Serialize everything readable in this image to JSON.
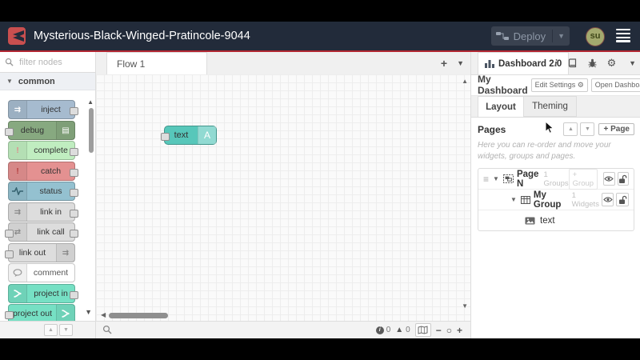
{
  "header": {
    "title": "Mysterious-Black-Winged-Pratincole-9044",
    "deploy_label": "Deploy",
    "user_initials": "su"
  },
  "palette": {
    "filter_placeholder": "filter nodes",
    "category_label": "common",
    "nodes": [
      {
        "label": "inject",
        "color": "#a6bbcf"
      },
      {
        "label": "debug",
        "color": "#87a980"
      },
      {
        "label": "complete",
        "color": "#c0edc0"
      },
      {
        "label": "catch",
        "color": "#e49191"
      },
      {
        "label": "status",
        "color": "#94c1d0"
      },
      {
        "label": "link in",
        "color": "#dddddd"
      },
      {
        "label": "link call",
        "color": "#dddddd"
      },
      {
        "label": "link out",
        "color": "#dddddd"
      },
      {
        "label": "comment",
        "color": "#ffffff"
      },
      {
        "label": "project in",
        "color": "#76e0c4"
      },
      {
        "label": "project out",
        "color": "#76e0c4"
      }
    ]
  },
  "workspace": {
    "flow_tab_label": "Flow 1",
    "canvas_node": {
      "label": "text",
      "icon_letter": "A",
      "color": "#57c7ba"
    }
  },
  "status_bar": {
    "info_count": "0",
    "warning_count": "0"
  },
  "sidebar": {
    "tab_label": "Dashboard 2.0",
    "dashboard_name": "My Dashboard",
    "edit_settings_label": "Edit Settings",
    "open_dashboard_label": "Open Dashboard",
    "tab_layout": "Layout",
    "tab_theming": "Theming",
    "pages_title": "Pages",
    "add_page_label": "+ Page",
    "help_text": "Here you can re-order and move your widgets, groups and pages.",
    "tree": {
      "page_name": "Page N",
      "page_count": "1 Groups",
      "add_group_label": "+ Group",
      "group_name": "My Group",
      "group_count": "1 Widgets",
      "widget_label": "text"
    }
  },
  "colors": {
    "header_bg": "#222b3a",
    "accent_red": "#b32733",
    "logo_red": "#c94f4f",
    "canvas_bg": "#fafafa"
  }
}
